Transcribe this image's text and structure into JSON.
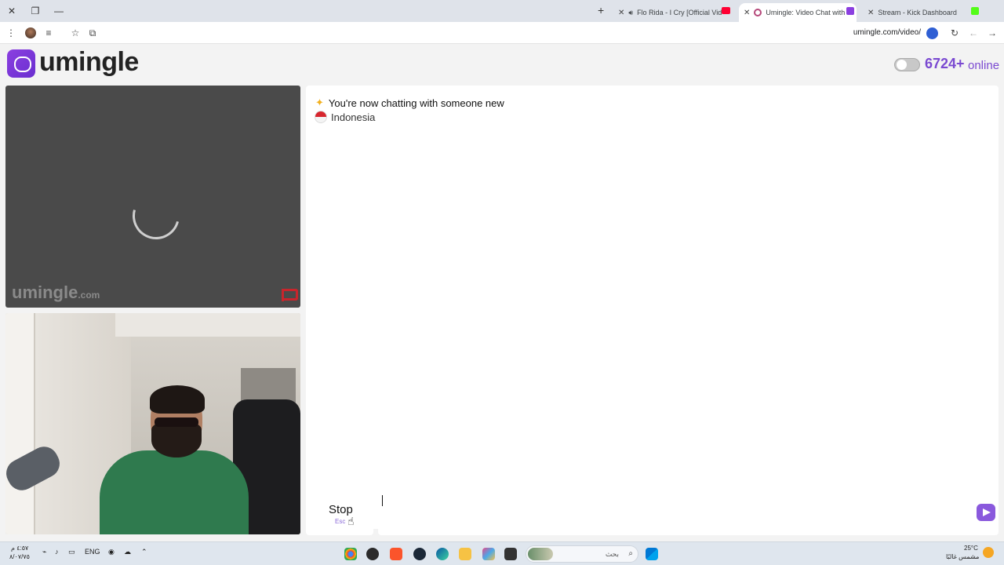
{
  "browser": {
    "tabs": [
      {
        "title": "Stream - Kick Dashboard",
        "active": false,
        "fav_color": "#53fc18"
      },
      {
        "title": "Umingle: Video Chat with St",
        "active": true,
        "fav_color": "#b5487a"
      },
      {
        "title": "Flo Rida - I Cry [Official Vid",
        "active": false,
        "fav_color": "#ff0033"
      }
    ],
    "url": "umingle.com/video/"
  },
  "header": {
    "logo_text": "umingle",
    "online_count": "6724+",
    "online_label": "online"
  },
  "remote_video": {
    "watermark_main": "umingle",
    "watermark_suffix": ".com"
  },
  "chat": {
    "status_message": "You're now chatting with someone new",
    "partner_country": "Indonesia",
    "input_value": ""
  },
  "controls": {
    "stop_label": "Stop",
    "stop_shortcut": "Esc"
  },
  "taskbar": {
    "search_placeholder": "بحث",
    "language": "ENG",
    "weather_temp": "25°C",
    "weather_desc": "مشمس غالبًا",
    "clock_time": "٤:٥٧ م",
    "clock_date": "٨/٠٧/٧٥"
  },
  "colors": {
    "brand": "#7a49d1",
    "send_button": "#8a59dd"
  }
}
